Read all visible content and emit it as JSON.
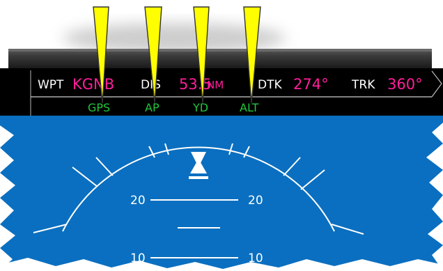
{
  "colors": {
    "sky": "#0a6fc0",
    "bezel_top": "#3a3a3a",
    "bezel_bottom": "#1a1a1a",
    "nav_bar": "#000000",
    "label_white": "#ffffff",
    "value_magenta": "#ff1e9a",
    "annunciator_green": "#21c63a",
    "callout_yellow": "#ffff00"
  },
  "nav_bar": {
    "wpt_label": "WPT",
    "wpt_value": "KGNB",
    "dis_label": "DIS",
    "dis_value": "53.5",
    "dis_unit": "NM",
    "dtk_label": "DTK",
    "dtk_value": "274°",
    "trk_label": "TRK",
    "trk_value": "360°"
  },
  "annunciators": [
    {
      "label": "GPS"
    },
    {
      "label": "AP"
    },
    {
      "label": "YD"
    },
    {
      "label": "ALT"
    }
  ],
  "attitude": {
    "pitch_ladder": [
      {
        "left": "20",
        "right": "20"
      },
      {
        "left": "10",
        "right": "10"
      }
    ]
  },
  "callouts": {
    "count": 4
  },
  "icons": {
    "roll_pointer": "roll-pointer-icon",
    "slip_indicator": "slip-skid-icon",
    "callout": "callout-pointer-icon"
  }
}
